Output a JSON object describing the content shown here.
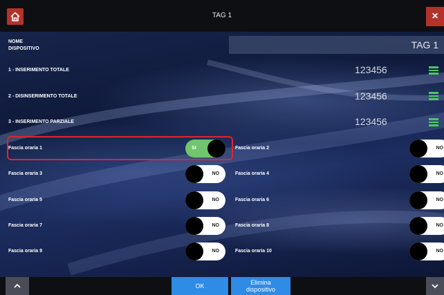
{
  "header": {
    "title": "TAG 1",
    "home_icon": "home-icon",
    "close_icon": "close-icon",
    "close_glyph": "×",
    "accent_color": "#b3322a"
  },
  "device": {
    "name_label_line1": "NOME",
    "name_label_line2": "DISPOSITIVO",
    "name_value": "TAG 1"
  },
  "codes": [
    {
      "label": "1 - INSERIMENTO TOTALE",
      "value": "123456"
    },
    {
      "label": "2 - DISINSERIMENTO TOTALE",
      "value": "123456"
    },
    {
      "label": "3 - INSERIMENTO PARZIALE",
      "value": "123456"
    }
  ],
  "time_slots": [
    {
      "label": "Fascia oraria 1",
      "state": "SI",
      "on": true
    },
    {
      "label": "Fascia oraria 2",
      "state": "NO",
      "on": false
    },
    {
      "label": "Fascia oraria 3",
      "state": "NO",
      "on": false
    },
    {
      "label": "Fascia oraria 4",
      "state": "NO",
      "on": false
    },
    {
      "label": "Fascia oraria 5",
      "state": "NO",
      "on": false
    },
    {
      "label": "Fascia oraria 6",
      "state": "NO",
      "on": false
    },
    {
      "label": "Fascia oraria 7",
      "state": "NO",
      "on": false
    },
    {
      "label": "Fascia oraria 8",
      "state": "NO",
      "on": false
    },
    {
      "label": "Fascia oraria 9",
      "state": "NO",
      "on": false
    },
    {
      "label": "Fascia oraria 10",
      "state": "NO",
      "on": false
    }
  ],
  "footer": {
    "ok_label": "OK",
    "delete_label_line1": "Elimina",
    "delete_label_line2": "dispositivo",
    "up_icon": "chevron-up-icon",
    "down_icon": "chevron-down-icon",
    "button_color": "#2e8be6"
  },
  "colors": {
    "toggle_on": "#72c56e",
    "menu_icon": "#4cc866",
    "highlight": "#e0252d"
  }
}
